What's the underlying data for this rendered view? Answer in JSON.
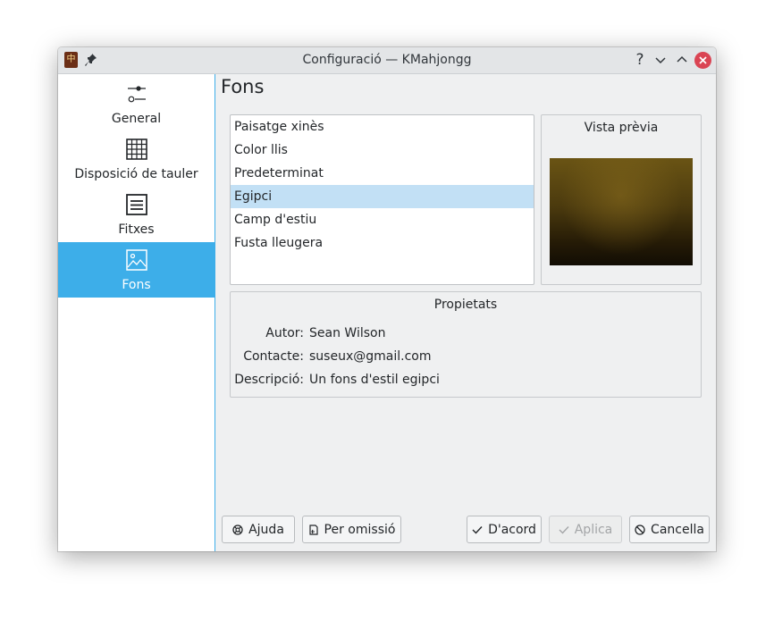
{
  "window": {
    "title": "Configuració — KMahjongg",
    "help_glyph": "?"
  },
  "sidebar": {
    "items": [
      {
        "label": "General",
        "icon": "slider-icon"
      },
      {
        "label": "Disposició de tauler",
        "icon": "grid-icon"
      },
      {
        "label": "Fitxes",
        "icon": "tiles-icon"
      },
      {
        "label": "Fons",
        "icon": "image-icon",
        "selected": true
      }
    ]
  },
  "page": {
    "title": "Fons"
  },
  "backgrounds": {
    "items": [
      "Paisatge xinès",
      "Color llis",
      "Predeterminat",
      "Egipci",
      "Camp d'estiu",
      "Fusta lleugera"
    ],
    "selected_index": 3
  },
  "preview": {
    "title": "Vista prèvia"
  },
  "properties": {
    "title": "Propietats",
    "author_label": "Autor:",
    "author": "Sean Wilson",
    "contact_label": "Contacte:",
    "contact": "suseux@gmail.com",
    "description_label": "Descripció:",
    "description": "Un fons d'estil egipci"
  },
  "buttons": {
    "help": "Ajuda",
    "defaults": "Per omissió",
    "ok": "D'acord",
    "apply": "Aplica",
    "cancel": "Cancella"
  },
  "colors": {
    "accent": "#3daee9",
    "selection": "#c2e0f5",
    "close": "#da4453"
  }
}
